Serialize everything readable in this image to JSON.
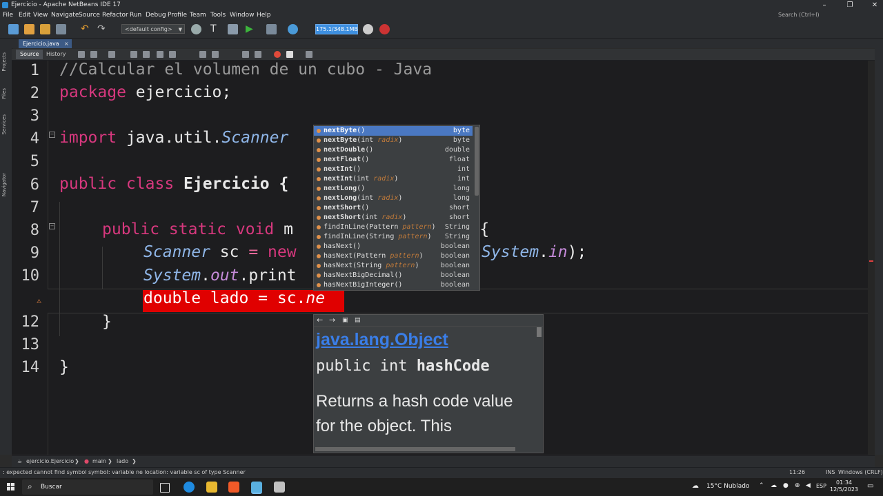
{
  "window": {
    "title": "Ejercicio - Apache NetBeans IDE 17"
  },
  "menubar": {
    "items": [
      "File",
      "Edit",
      "View",
      "Navigate",
      "Source",
      "Refactor",
      "Run",
      "Debug",
      "Profile",
      "Team",
      "Tools",
      "Window",
      "Help"
    ],
    "search_placeholder": "Search (Ctrl+I)"
  },
  "toolbar": {
    "config": "<default config>",
    "memory": "175.1/348.1MB"
  },
  "sidebar": {
    "labels": [
      "Projects",
      "Files",
      "Services",
      "Navigator"
    ]
  },
  "editor_tab": {
    "label": "Ejercicio.java",
    "close": "×"
  },
  "source_tabs": {
    "source": "Source",
    "history": "History"
  },
  "code": {
    "line_numbers": [
      "1",
      "2",
      "3",
      "4",
      "5",
      "6",
      "7",
      "8",
      "9",
      "10",
      "",
      "12",
      "13",
      "14"
    ],
    "l1": "//Calcular el volumen de un cubo - Java",
    "l2_kw": "package",
    "l2_rest": " ejercicio;",
    "l4_kw": "import",
    "l4_a": " java.util.",
    "l4_b": "Scanner",
    "l6_kw": "public class",
    "l6_rest": " Ejercicio {",
    "l8_kw": "public static void",
    "l8_a": " m",
    "l8_b": "gs) {",
    "l9_a": "Scanner",
    "l9_b": " sc ",
    "l9_c": "=",
    "l9_d": " new",
    "l9_e": "System",
    "l9_f": ".",
    "l9_g": "in",
    "l9_h": ");",
    "l10_a": "System",
    "l10_b": ".",
    "l10_c": "out",
    "l10_d": ".print",
    "l11_a": "double lado = sc.",
    "l11_b": "ne",
    "l12": "}",
    "l14": "}"
  },
  "completion": {
    "items": [
      {
        "name_bold": "nextByte",
        "name_rest": "()",
        "param": "",
        "after": "",
        "type": "byte",
        "selected": true
      },
      {
        "name_bold": "nextByte",
        "name_rest": "(int ",
        "param": "radix",
        "after": ")",
        "type": "byte"
      },
      {
        "name_bold": "nextDouble",
        "name_rest": "()",
        "param": "",
        "after": "",
        "type": "double"
      },
      {
        "name_bold": "nextFloat",
        "name_rest": "()",
        "param": "",
        "after": "",
        "type": "float"
      },
      {
        "name_bold": "nextInt",
        "name_rest": "()",
        "param": "",
        "after": "",
        "type": "int"
      },
      {
        "name_bold": "nextInt",
        "name_rest": "(int ",
        "param": "radix",
        "after": ")",
        "type": "int"
      },
      {
        "name_bold": "nextLong",
        "name_rest": "()",
        "param": "",
        "after": "",
        "type": "long"
      },
      {
        "name_bold": "nextLong",
        "name_rest": "(int ",
        "param": "radix",
        "after": ")",
        "type": "long"
      },
      {
        "name_bold": "nextShort",
        "name_rest": "()",
        "param": "",
        "after": "",
        "type": "short"
      },
      {
        "name_bold": "nextShort",
        "name_rest": "(int ",
        "param": "radix",
        "after": ")",
        "type": "short"
      },
      {
        "name_bold": "",
        "name_rest": "findInLine(Pattern ",
        "param": "pattern",
        "after": ")",
        "type": "String"
      },
      {
        "name_bold": "",
        "name_rest": "findInLine(String ",
        "param": "pattern",
        "after": ")",
        "type": "String"
      },
      {
        "name_bold": "",
        "name_rest": "hasNext()",
        "param": "",
        "after": "",
        "type": "boolean"
      },
      {
        "name_bold": "",
        "name_rest": "hasNext(Pattern ",
        "param": "pattern",
        "after": ")",
        "type": "boolean"
      },
      {
        "name_bold": "",
        "name_rest": "hasNext(String ",
        "param": "pattern",
        "after": ")",
        "type": "boolean"
      },
      {
        "name_bold": "",
        "name_rest": "hasNextBigDecimal()",
        "param": "",
        "after": "",
        "type": "boolean"
      },
      {
        "name_bold": "",
        "name_rest": "hasNextBigInteger()",
        "param": "",
        "after": "",
        "type": "boolean"
      }
    ]
  },
  "javadoc": {
    "link": "java.lang.Object",
    "sig_prefix": "public int ",
    "sig_name": "hashCode",
    "desc": "Returns a hash code value for the object. This"
  },
  "breadcrumb": {
    "items": [
      "ejercicio.Ejercicio",
      "main",
      "lado"
    ]
  },
  "statusbar": {
    "message": ": expected  cannot find symbol  symbol:  variable ne  location: variable sc of type Scanner",
    "position": "11:26",
    "mode": "INS",
    "line_ending": "Windows (CRLF)"
  },
  "taskbar": {
    "search": "Buscar",
    "weather": "15°C  Nublado",
    "lang": "ESP",
    "time": "01:34",
    "date": "12/5/2023"
  }
}
